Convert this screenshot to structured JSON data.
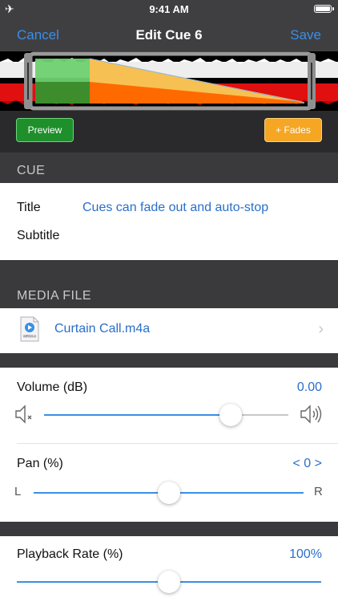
{
  "status": {
    "time": "9:41 AM"
  },
  "nav": {
    "cancel": "Cancel",
    "title": "Edit Cue 6",
    "save": "Save"
  },
  "toolbar": {
    "preview": "Preview",
    "fades": "+ Fades"
  },
  "cue": {
    "header": "CUE",
    "title_label": "Title",
    "title_value": "Cues can fade out and auto-stop",
    "subtitle_label": "Subtitle"
  },
  "media": {
    "header": "MEDIA FILE",
    "file_name": "Curtain Call.m4a",
    "file_type": "MPEG-4"
  },
  "volume": {
    "label": "Volume (dB)",
    "value": "0.00",
    "level": 0.77
  },
  "pan": {
    "label": "Pan (%)",
    "value": "< 0 >",
    "left": "L",
    "right": "R",
    "level": 0.5
  },
  "rate": {
    "label": "Playback Rate (%)",
    "value": "100%",
    "level": 0.5
  },
  "colors": {
    "accent": "#3b8fe6",
    "preview_green": "#1e8f2b",
    "fades_orange": "#f5a623",
    "wave_red": "#e01010"
  }
}
